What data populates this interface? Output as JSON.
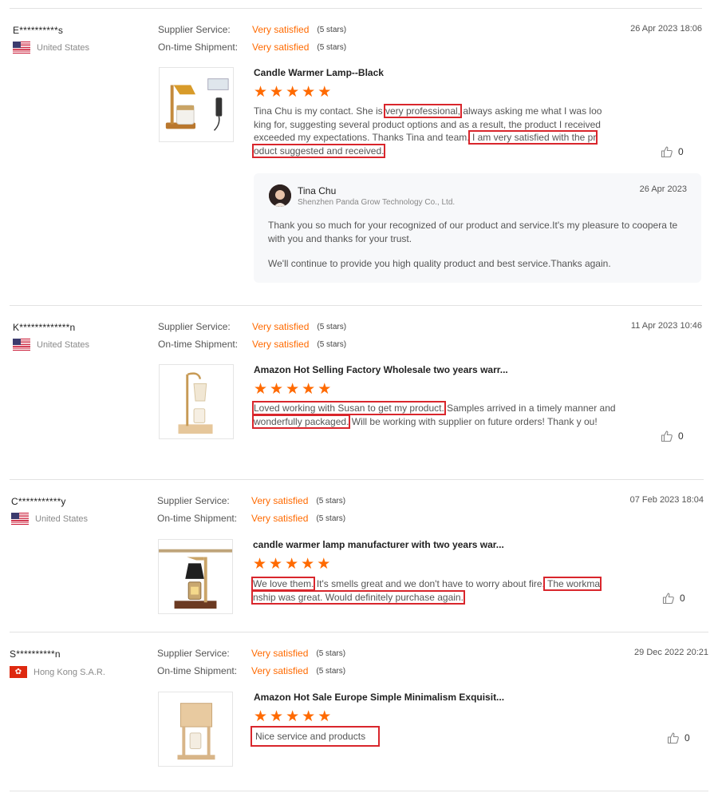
{
  "reviews": [
    {
      "buyer": "E**********s",
      "country": "United States",
      "supplier_service_label": "Supplier Service:",
      "supplier_service_value": "Very satisfied",
      "supplier_service_stars": "(5 stars)",
      "shipment_label": "On-time Shipment:",
      "shipment_value": "Very satisfied",
      "shipment_stars": "(5 stars)",
      "date": "26 Apr 2023 18:06",
      "product_title": "Candle Warmer Lamp--Black",
      "comment_parts": [
        "Tina Chu is my contact. She is ",
        "very professional,",
        " always asking me what I was loo king for, suggesting several product options and as a result, the product I received exceeded my expectations. Thanks Tina and team.",
        " I am very satisfied with the pr oduct suggested and received."
      ],
      "likes": "0",
      "reply": {
        "name": "Tina Chu",
        "company": "Shenzhen Panda Grow Technology Co., Ltd.",
        "date": "26 Apr 2023",
        "text1": "Thank you so much for your recognized of our product and service.It's my pleasure to coopera te with you and thanks for your trust.",
        "text2": "We'll continue to provide you high quality product and best service.Thanks again."
      }
    },
    {
      "buyer": "K*************n",
      "country": "United States",
      "supplier_service_label": "Supplier Service:",
      "supplier_service_value": "Very satisfied",
      "supplier_service_stars": "(5 stars)",
      "shipment_label": "On-time Shipment:",
      "shipment_value": "Very satisfied",
      "shipment_stars": "(5 stars)",
      "date": "11 Apr 2023 10:46",
      "product_title": "Amazon Hot Selling Factory Wholesale two years warr...",
      "comment_parts": [
        "Loved working with Susan to get my product.",
        " Samples arrived in a timely manner and ",
        "wonderfully packaged.",
        " Will be working with supplier on future orders! Thank y ou!"
      ],
      "likes": "0"
    },
    {
      "buyer": "C***********y",
      "country": "United States",
      "supplier_service_label": "Supplier Service:",
      "supplier_service_value": "Very satisfied",
      "supplier_service_stars": "(5 stars)",
      "shipment_label": "On-time Shipment:",
      "shipment_value": "Very satisfied",
      "shipment_stars": "(5 stars)",
      "date": "07 Feb 2023 18:04",
      "product_title": "candle warmer lamp manufacturer with two years war...",
      "comment_parts": [
        "We love them.",
        " It's smells great and we don't have to worry about fire.",
        " The workma nship was great. Would definitely purchase again."
      ],
      "likes": "0"
    },
    {
      "buyer": "S**********n",
      "country": "Hong Kong S.A.R.",
      "supplier_service_label": "Supplier Service:",
      "supplier_service_value": "Very satisfied",
      "supplier_service_stars": "(5 stars)",
      "shipment_label": "On-time Shipment:",
      "shipment_value": "Very satisfied",
      "shipment_stars": "(5 stars)",
      "date": "29 Dec 2022 20:21",
      "product_title": "Amazon Hot Sale Europe Simple Minimalism Exquisit...",
      "comment_parts": [
        "Nice service and products"
      ],
      "likes": "0"
    }
  ],
  "star_glyph": "★",
  "like_icon": "thumbs-up-icon",
  "accent_color": "#ff6a00",
  "highlight_color": "#d9262c"
}
